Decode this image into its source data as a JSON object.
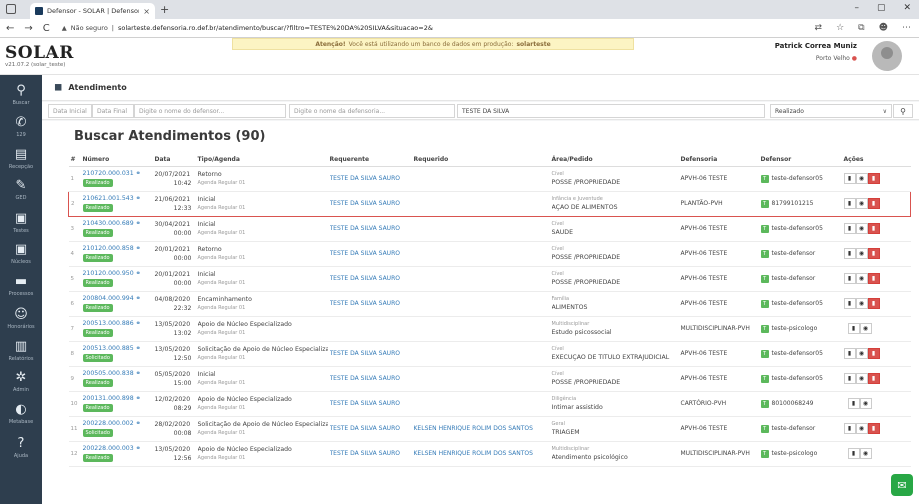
{
  "browser": {
    "tab_title": "Defensor - SOLAR | Defensoria P",
    "tab_close": "×",
    "new_tab": "+",
    "window_controls": [
      "–",
      "▢",
      "✕"
    ],
    "nav": [
      "←",
      "→",
      "C"
    ],
    "security": "Não seguro",
    "url": "solarteste.defensoria.ro.def.br/atendimento/buscar/?filtro=TESTE%20DA%20SILVA&situacao=2&",
    "icons": [
      "translate-icon",
      "star-icon",
      "tab-icon",
      "profile-icon",
      "menu-icon"
    ]
  },
  "app": {
    "logo": "SOLAR",
    "version": "v21.07.2 (solar_teste)",
    "alert_prefix": "Atenção!",
    "alert_text": "Você está utilizando um banco de dados em produção:",
    "alert_db": "solarteste",
    "user_name": "Patrick Correa Muniz",
    "user_location": "Porto Velho",
    "user_flag": "●"
  },
  "sidebar": [
    {
      "icon": "search-icon",
      "glyph": "⚲",
      "label": "Buscar"
    },
    {
      "icon": "phone-icon",
      "glyph": "✆",
      "label": "129"
    },
    {
      "icon": "calendar-icon",
      "glyph": "▤",
      "label": "Recepção"
    },
    {
      "icon": "edit-icon",
      "glyph": "✎",
      "label": "GED"
    },
    {
      "icon": "briefcase-icon",
      "glyph": "▣",
      "label": "Testes"
    },
    {
      "icon": "building-icon",
      "glyph": "▣",
      "label": "Núcleos"
    },
    {
      "icon": "folder-icon",
      "glyph": "▬",
      "label": "Processos"
    },
    {
      "icon": "user-icon",
      "glyph": "☺",
      "label": "Honorários"
    },
    {
      "icon": "chart-icon",
      "glyph": "▥",
      "label": "Relatórios"
    },
    {
      "icon": "cogs-icon",
      "glyph": "✲",
      "label": "Admin"
    },
    {
      "icon": "database-icon",
      "glyph": "◐",
      "label": "Metabase"
    },
    {
      "icon": "help-icon",
      "glyph": "?",
      "label": "Ajuda"
    }
  ],
  "page": {
    "header_title": "Atendimento",
    "results_title": "Buscar Atendimentos (90)"
  },
  "filters": {
    "data_inicial": "Data Inicial",
    "data_final": "Data Final",
    "defensor": "Digite o nome do defensor...",
    "defensoria": "Digite o nome da defensoria...",
    "filtro": "TESTE DA SILVA",
    "situacao": "Realizado",
    "caret": "∨",
    "search": "⚲"
  },
  "table": {
    "headers": [
      "#",
      "Número",
      "Data",
      "Tipo/Agenda",
      "Requerente",
      "Requerido",
      "Área/Pedido",
      "Defensoria",
      "Defensor",
      "Ações"
    ],
    "rows": [
      {
        "i": "1",
        "numero": "210720.000.031",
        "status": "Realizado",
        "data": "20/07/2021",
        "hora": "10:42",
        "tipo": "Retorno",
        "agenda": "Agenda Regular 01",
        "requerente": "TESTE DA SILVA SAURO",
        "requerido": "",
        "area": "Cível",
        "pedido": "POSSE /PROPRIEDADE",
        "defensoria": "APVH-06 TESTE",
        "defensor": "teste-defensor05",
        "hl": false,
        "del": true
      },
      {
        "i": "2",
        "numero": "210621.001.543",
        "status": "Realizado",
        "data": "21/06/2021",
        "hora": "12:33",
        "tipo": "Inicial",
        "agenda": "Agenda Regular 01",
        "requerente": "TESTE DA SILVA SAURO",
        "requerido": "",
        "area": "Infância e Juventude",
        "pedido": "AÇÃO DE ALIMENTOS",
        "defensoria": "PLANTÃO-PVH",
        "defensor": "81799101215",
        "hl": true,
        "del": true
      },
      {
        "i": "3",
        "numero": "210430.000.689",
        "status": "Realizado",
        "data": "30/04/2021",
        "hora": "00:00",
        "tipo": "Inicial",
        "agenda": "Agenda Regular 01",
        "requerente": "TESTE DA SILVA SAURO",
        "requerido": "",
        "area": "Cível",
        "pedido": "SAÚDE",
        "defensoria": "APVH-06 TESTE",
        "defensor": "teste-defensor05",
        "hl": false,
        "del": true
      },
      {
        "i": "4",
        "numero": "210120.000.858",
        "status": "Realizado",
        "data": "20/01/2021",
        "hora": "00:00",
        "tipo": "Retorno",
        "agenda": "Agenda Regular 01",
        "requerente": "TESTE DA SILVA SAURO",
        "requerido": "",
        "area": "Cível",
        "pedido": "POSSE /PROPRIEDADE",
        "defensoria": "APVH-06 TESTE",
        "defensor": "teste-defensor",
        "hl": false,
        "del": true
      },
      {
        "i": "5",
        "numero": "210120.000.950",
        "status": "Realizado",
        "data": "20/01/2021",
        "hora": "00:00",
        "tipo": "Inicial",
        "agenda": "Agenda Regular 01",
        "requerente": "TESTE DA SILVA SAURO",
        "requerido": "",
        "area": "Cível",
        "pedido": "POSSE /PROPRIEDADE",
        "defensoria": "APVH-06 TESTE",
        "defensor": "teste-defensor",
        "hl": false,
        "del": true
      },
      {
        "i": "6",
        "numero": "200804.000.994",
        "status": "Realizado",
        "data": "04/08/2020",
        "hora": "22:32",
        "tipo": "Encaminhamento",
        "agenda": "Agenda Regular 01",
        "requerente": "TESTE DA SILVA SAURO",
        "requerido": "",
        "area": "Família",
        "pedido": "ALIMENTOS",
        "defensoria": "APVH-06 TESTE",
        "defensor": "teste-defensor05",
        "hl": false,
        "del": true
      },
      {
        "i": "7",
        "numero": "200513.000.886",
        "status": "Realizado",
        "data": "13/05/2020",
        "hora": "13:02",
        "tipo": "Apoio de Núcleo Especializado",
        "agenda": "Agenda Regular 01",
        "requerente": "",
        "requerido": "",
        "area": "Multidisciplinar",
        "pedido": "Estudo psicossocial",
        "defensoria": "MULTIDISCIPLINAR-PVH",
        "defensor": "teste-psicologo",
        "hl": false,
        "del": false
      },
      {
        "i": "8",
        "numero": "200513.000.885",
        "status": "Solicitado",
        "data": "13/05/2020",
        "hora": "12:50",
        "tipo": "Solicitação de Apoio de Núcleo Especializado",
        "agenda": "Agenda Regular 01",
        "requerente": "TESTE DA SILVA SAURO",
        "requerido": "",
        "area": "Cível",
        "pedido": "EXECUÇÃO DE TITULO EXTRAJUDICIAL",
        "defensoria": "APVH-06 TESTE",
        "defensor": "teste-defensor05",
        "hl": false,
        "del": true
      },
      {
        "i": "9",
        "numero": "200505.000.838",
        "status": "Realizado",
        "data": "05/05/2020",
        "hora": "15:00",
        "tipo": "Inicial",
        "agenda": "Agenda Regular 01",
        "requerente": "TESTE DA SILVA SAURO",
        "requerido": "",
        "area": "Cível",
        "pedido": "POSSE /PROPRIEDADE",
        "defensoria": "APVH-06 TESTE",
        "defensor": "teste-defensor05",
        "hl": false,
        "del": true
      },
      {
        "i": "10",
        "numero": "200131.000.898",
        "status": "Realizado",
        "data": "12/02/2020",
        "hora": "08:29",
        "tipo": "Apoio de Núcleo Especializado",
        "agenda": "Agenda Regular 01",
        "requerente": "TESTE DA SILVA SAURO",
        "requerido": "",
        "area": "Diligência",
        "pedido": "Intimar assistido",
        "defensoria": "CARTÓRIO-PVH",
        "defensor": "80100068249",
        "hl": false,
        "del": false
      },
      {
        "i": "11",
        "numero": "200228.000.002",
        "status": "Solicitado",
        "data": "28/02/2020",
        "hora": "00:08",
        "tipo": "Solicitação de Apoio de Núcleo Especializado",
        "agenda": "Agenda Regular 01",
        "requerente": "TESTE DA SILVA SAURO",
        "requerido": "KELSEN HENRIQUE ROLIM DOS SANTOS",
        "area": "Geral",
        "pedido": "TRIAGEM",
        "defensoria": "APVH-06 TESTE",
        "defensor": "teste-defensor",
        "hl": false,
        "del": true
      },
      {
        "i": "12",
        "numero": "200228.000.003",
        "status": "Realizado",
        "data": "13/05/2020",
        "hora": "12:56",
        "tipo": "Apoio de Núcleo Especializado",
        "agenda": "Agenda Regular 01",
        "requerente": "TESTE DA SILVA SAURO",
        "requerido": "KELSEN HENRIQUE ROLIM DOS SANTOS",
        "area": "Multidisciplinar",
        "pedido": "Atendimento psicológico",
        "defensoria": "MULTIDISCIPLINAR-PVH",
        "defensor": "teste-psicologo",
        "hl": false,
        "del": false
      }
    ]
  },
  "action_glyphs": {
    "print": "▮",
    "view": "◉",
    "delete": "▮"
  },
  "chat_glyph": "✉"
}
